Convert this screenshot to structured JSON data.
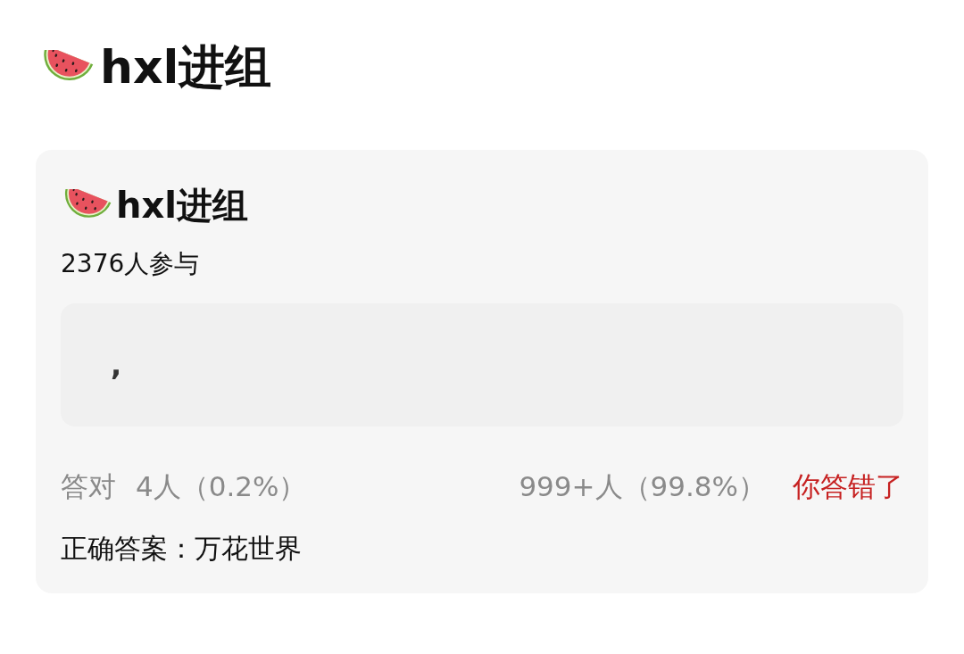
{
  "page_title": {
    "text": "hxl进组"
  },
  "quiz": {
    "title": "hxl进组",
    "participants": "2376人参与",
    "answer_box": {
      "value": ","
    },
    "stats": {
      "correct_label": "答对",
      "correct_count": "4人（0.2%）",
      "wrong_count": "999+人（99.8%）"
    },
    "verdict": {
      "text": "你答错了",
      "correct": false
    },
    "correct_answer": "正确答案：万花世界"
  }
}
